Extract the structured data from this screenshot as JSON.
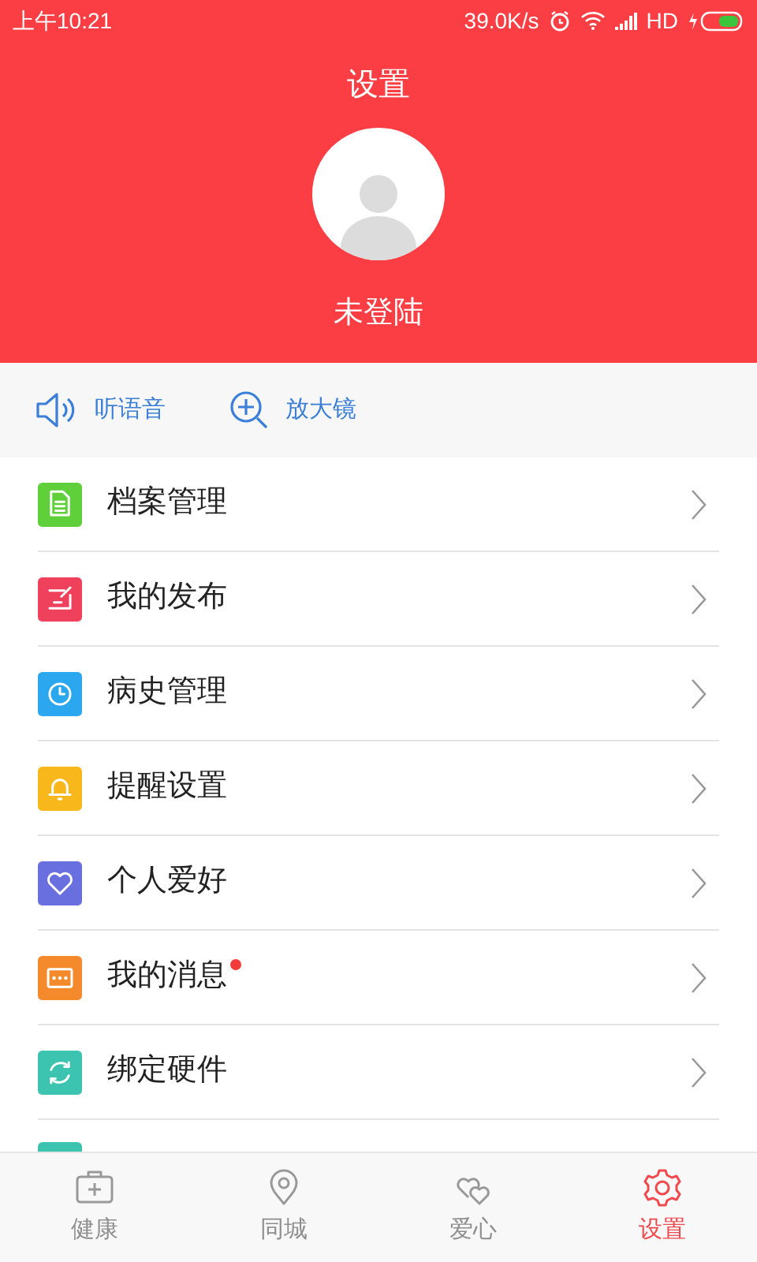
{
  "status_bar": {
    "time": "上午10:21",
    "speed": "39.0K/s",
    "network": "HD"
  },
  "header": {
    "title": "设置",
    "user_name": "未登陆"
  },
  "tools": [
    {
      "label": "听语音",
      "kind": "speaker"
    },
    {
      "label": "放大镜",
      "kind": "zoom"
    }
  ],
  "menu": [
    {
      "label": "档案管理",
      "kind": "file",
      "color": "#5fcf3a",
      "badge": false
    },
    {
      "label": "我的发布",
      "kind": "edit",
      "color": "#f0415c",
      "badge": false
    },
    {
      "label": "病史管理",
      "kind": "clock",
      "color": "#2aa7ee",
      "badge": false
    },
    {
      "label": "提醒设置",
      "kind": "bell",
      "color": "#f8b81c",
      "badge": false
    },
    {
      "label": "个人爱好",
      "kind": "heart",
      "color": "#6a6fe0",
      "badge": false
    },
    {
      "label": "我的消息",
      "kind": "chat",
      "color": "#f58a2c",
      "badge": true
    },
    {
      "label": "绑定硬件",
      "kind": "sync",
      "color": "#3cc4b0",
      "badge": false
    }
  ],
  "tabs": [
    {
      "label": "健康",
      "kind": "kit",
      "selected": false
    },
    {
      "label": "同城",
      "kind": "pin",
      "selected": false
    },
    {
      "label": "爱心",
      "kind": "hearts",
      "selected": false
    },
    {
      "label": "设置",
      "kind": "gear",
      "selected": true
    }
  ]
}
